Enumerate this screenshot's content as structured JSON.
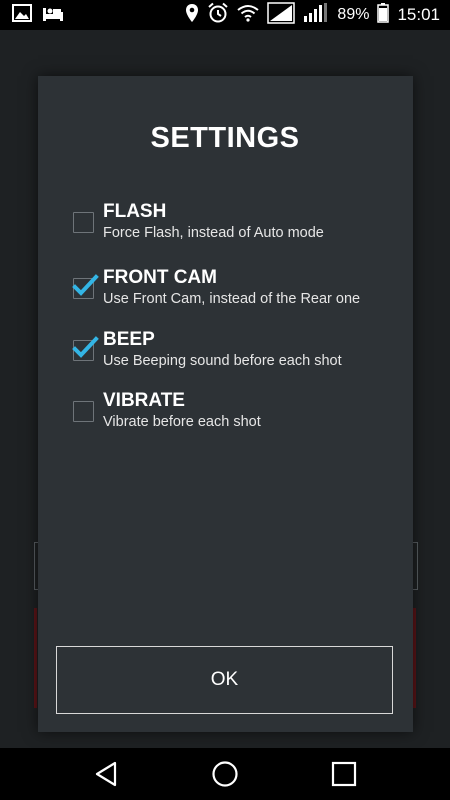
{
  "status_bar": {
    "left_icons": [
      "image-icon",
      "bed-icon"
    ],
    "right_icons": [
      "location-icon",
      "alarm-icon",
      "wifi-icon",
      "signal-icon",
      "signal-icon",
      "battery-icon"
    ],
    "battery": "89%",
    "time": "15:01"
  },
  "dialog": {
    "title": "SETTINGS",
    "options": [
      {
        "title": "FLASH",
        "description": "Force Flash, instead of Auto mode",
        "checked": false
      },
      {
        "title": "FRONT CAM",
        "description": "Use Front Cam, instead of the Rear one",
        "checked": true
      },
      {
        "title": "BEEP",
        "description": "Use Beeping sound before each shot",
        "checked": true
      },
      {
        "title": "VIBRATE",
        "description": "Vibrate before each shot",
        "checked": false
      }
    ],
    "ok_label": "OK"
  },
  "nav_bar": {
    "buttons": [
      "back-icon",
      "home-icon",
      "recents-icon"
    ]
  },
  "colors": {
    "accent_check": "#33b5e5",
    "dialog_bg": "#2d3236",
    "backdrop": "#202325"
  }
}
